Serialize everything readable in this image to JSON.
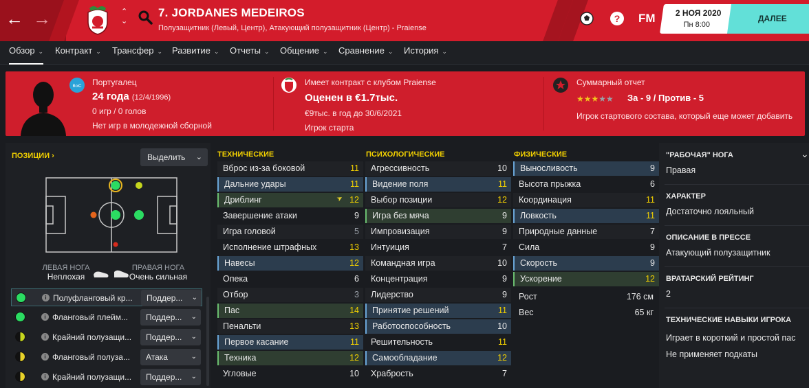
{
  "header": {
    "title": "7. JORDANES MEDEIROS",
    "subtitle": "Полузащитник (Левый, Центр), Атакующий полузащитник (Центр) - Praiense",
    "right_icons": [
      "FM"
    ],
    "date": "2 НОЯ 2020",
    "day_time": "Пн 8:00",
    "continue_label": "ДАЛЕЕ"
  },
  "tabs": [
    {
      "label": "Обзор"
    },
    {
      "label": "Контракт"
    },
    {
      "label": "Трансфер"
    },
    {
      "label": "Развитие"
    },
    {
      "label": "Отчеты"
    },
    {
      "label": "Общение"
    },
    {
      "label": "Сравнение"
    },
    {
      "label": "История"
    }
  ],
  "banner": {
    "nationality": "Португалец",
    "age": "24 года",
    "birthdate": "(12/4/1996)",
    "games": "0 игр / 0 голов",
    "youth": "Нет игр в молодежной сборной",
    "contract": "Имеет контракт с клубом Praiense",
    "value": "Оценен в €1.7тыс.",
    "wage": "€9тыс. в год до 30/6/2021",
    "status": "Игрок старта",
    "report_title": "Суммарный отчет",
    "stars_value": 3,
    "stars_max": 5,
    "pros_cons": "За - 9 / Против - 5",
    "report_desc": "Игрок стартового состава, который еще может добавить"
  },
  "positions": {
    "title": "ПОЗИЦИИ",
    "select_label": "Выделить",
    "left_foot_label": "ЛЕВАЯ НОГА",
    "left_foot_value": "Неплохая",
    "right_foot_label": "ПРАВАЯ НОГА",
    "right_foot_value": "Очень сильная",
    "roles": [
      {
        "name": "Полуфланговый кр...",
        "duty": "Поддер...",
        "color": "#2bdc62",
        "half": false
      },
      {
        "name": "Фланговый плейм...",
        "duty": "Поддер...",
        "color": "#2bdc62",
        "half": false
      },
      {
        "name": "Крайний полузащи...",
        "duty": "Поддер...",
        "color": "#c6d61e",
        "half": true
      },
      {
        "name": "Фланговый полуза...",
        "duty": "Атака",
        "color": "#e8d22a",
        "half": true
      },
      {
        "name": "Крайний полузащи...",
        "duty": "Поддер...",
        "color": "#e8d22a",
        "half": true
      }
    ]
  },
  "technical": {
    "title": "ТЕХНИЧЕСКИЕ",
    "attrs": [
      {
        "name": "Вброс из-за боковой",
        "value": "11"
      },
      {
        "name": "Дальние удары",
        "value": "11"
      },
      {
        "name": "Дриблинг",
        "value": "12"
      },
      {
        "name": "Завершение атаки",
        "value": "9"
      },
      {
        "name": "Игра головой",
        "value": "5"
      },
      {
        "name": "Исполнение штрафных",
        "value": "13"
      },
      {
        "name": "Навесы",
        "value": "12"
      },
      {
        "name": "Опека",
        "value": "6"
      },
      {
        "name": "Отбор",
        "value": "3"
      },
      {
        "name": "Пас",
        "value": "14"
      },
      {
        "name": "Пенальти",
        "value": "13"
      },
      {
        "name": "Первое касание",
        "value": "11"
      },
      {
        "name": "Техника",
        "value": "12"
      },
      {
        "name": "Угловые",
        "value": "10"
      }
    ]
  },
  "mental": {
    "title": "ПСИХОЛОГИЧЕСКИЕ",
    "attrs": [
      {
        "name": "Агрессивность",
        "value": "10"
      },
      {
        "name": "Видение поля",
        "value": "11"
      },
      {
        "name": "Выбор позиции",
        "value": "12"
      },
      {
        "name": "Игра без мяча",
        "value": "9"
      },
      {
        "name": "Импровизация",
        "value": "9"
      },
      {
        "name": "Интуиция",
        "value": "7"
      },
      {
        "name": "Командная игра",
        "value": "10"
      },
      {
        "name": "Концентрация",
        "value": "9"
      },
      {
        "name": "Лидерство",
        "value": "9"
      },
      {
        "name": "Принятие решений",
        "value": "11"
      },
      {
        "name": "Работоспособность",
        "value": "10"
      },
      {
        "name": "Решительность",
        "value": "11"
      },
      {
        "name": "Самообладание",
        "value": "12"
      },
      {
        "name": "Храбрость",
        "value": "7"
      }
    ]
  },
  "physical": {
    "title": "ФИЗИЧЕСКИЕ",
    "attrs": [
      {
        "name": "Выносливость",
        "value": "9"
      },
      {
        "name": "Высота прыжка",
        "value": "6"
      },
      {
        "name": "Координация",
        "value": "11"
      },
      {
        "name": "Ловкость",
        "value": "11"
      },
      {
        "name": "Природные данные",
        "value": "7"
      },
      {
        "name": "Сила",
        "value": "9"
      },
      {
        "name": "Скорость",
        "value": "9"
      },
      {
        "name": "Ускорение",
        "value": "12"
      }
    ],
    "height_label": "Рост",
    "height_value": "176 см",
    "weight_label": "Вес",
    "weight_value": "65 кг"
  },
  "info": {
    "foot_title": "\"РАБОЧАЯ\" НОГА",
    "foot_value": "Правая",
    "char_title": "ХАРАКТЕР",
    "char_value": "Достаточно лояльный",
    "press_title": "ОПИСАНИЕ В ПРЕССЕ",
    "press_value": "Атакующий полузащитник",
    "gk_title": "ВРАТАРСКИЙ РЕЙТИНГ",
    "gk_value": "2",
    "skills_title": "ТЕХНИЧЕСКИЕ НАВЫКИ ИГРОКА",
    "skill_1": "Играет в короткий и простой пас",
    "skill_2": "Не применяет подкаты"
  }
}
